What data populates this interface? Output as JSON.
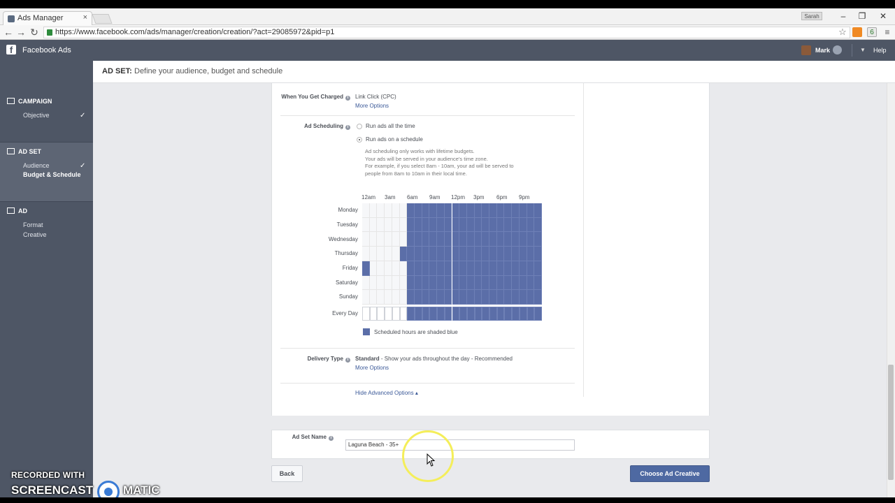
{
  "browser": {
    "tab_title": "Ads Manager",
    "tab_close": "×",
    "url": "https://www.facebook.com/ads/manager/creation/creation/?act=29085972&pid=p1",
    "back": "←",
    "forward": "→",
    "reload": "↻",
    "star": "☆",
    "ext_badge": "6",
    "minimize": "‒",
    "restore": "❐",
    "close": "✕",
    "user_chip": "Sarah"
  },
  "app": {
    "logo": "f",
    "title": "Facebook Ads",
    "user_name": "Mark",
    "help": "Help",
    "caret": "▼"
  },
  "sidebar": {
    "campaign": {
      "title": "CAMPAIGN",
      "items": [
        {
          "label": "Objective",
          "check": "✓"
        }
      ]
    },
    "adset": {
      "title": "AD SET",
      "items": [
        {
          "label": "Audience",
          "check": "✓"
        },
        {
          "label": "Budget & Schedule"
        }
      ]
    },
    "ad": {
      "title": "AD",
      "items": [
        {
          "label": "Format"
        },
        {
          "label": "Creative"
        }
      ]
    }
  },
  "header": {
    "section": "AD SET:",
    "subtitle": "Define your audience, budget and schedule"
  },
  "form": {
    "charged_label": "When You Get Charged",
    "charged_value": "Link Click (CPC)",
    "more_options_1": "More Options",
    "scheduling_label": "Ad Scheduling",
    "radio_all_time": "Run ads all the time",
    "radio_schedule": "Run ads on a schedule",
    "note_lines": [
      "Ad scheduling only works with lifetime budgets.",
      "Your ads will be served in your audience's time zone.",
      "For example, if you select 8am - 10am, your ad will be served to",
      "people from 8am to 10am in their local time."
    ],
    "hour_labels": [
      "12am",
      "3am",
      "6am",
      "9am",
      "12pm",
      "3pm",
      "6pm",
      "9pm"
    ],
    "days": [
      "Monday",
      "Tuesday",
      "Wednesday",
      "Thursday",
      "Friday",
      "Saturday",
      "Sunday"
    ],
    "every_day": "Every Day",
    "legend": "Scheduled hours are shaded blue",
    "delivery_label": "Delivery Type",
    "delivery_value_bold": "Standard",
    "delivery_value_rest": " - Show your ads throughout the day - Recommended",
    "more_options_2": "More Options",
    "hide_advanced": "Hide Advanced Options ▴",
    "info_glyph": "i"
  },
  "schedule": {
    "slot_hours": [
      0,
      2,
      4,
      6,
      8,
      10,
      12,
      14,
      16,
      18,
      20,
      22
    ],
    "monday": [
      0,
      0,
      0,
      1,
      1,
      1,
      1,
      1,
      1,
      1,
      1,
      1
    ],
    "tuesday": [
      0,
      0,
      0,
      1,
      1,
      1,
      1,
      1,
      1,
      1,
      1,
      1
    ],
    "wednesday": [
      0,
      0,
      0,
      1,
      1,
      1,
      1,
      1,
      1,
      1,
      1,
      1
    ],
    "thursday_extra": {
      "day": "Thursday",
      "hour": 5
    },
    "friday_extra": {
      "day": "Friday",
      "hour": 0
    },
    "scheduled_from_hour": 6,
    "scheduled_to_hour": 24
  },
  "adset_name": {
    "label": "Ad Set Name",
    "value": "Laguna Beach - 35+"
  },
  "footer": {
    "back": "Back",
    "choose": "Choose Ad Creative"
  },
  "watermark": {
    "line1": "RECORDED WITH",
    "left": "SCREENCAST",
    "right": "MATIC"
  },
  "colors": {
    "header_bg": "#4e5665",
    "scheduled_blue": "#5b6ea8",
    "link": "#3b5998",
    "primary_button": "#4e69a2"
  }
}
